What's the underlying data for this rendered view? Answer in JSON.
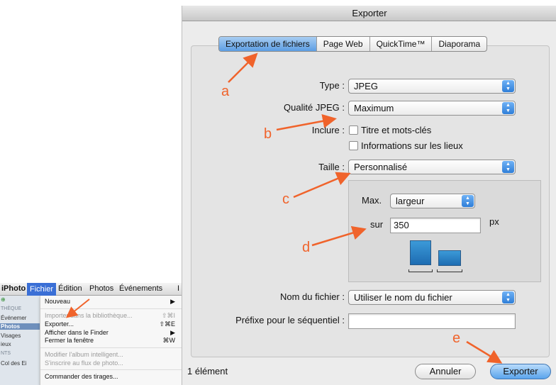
{
  "iphoto_menu": {
    "app_name": "iPhoto",
    "menus": [
      "Fichier",
      "Édition",
      "Photos",
      "Événements",
      "I"
    ],
    "sidebar": {
      "items": [
        {
          "label": "⊕",
          "type": "icon"
        },
        {
          "label": "THÈQUE",
          "type": "header"
        },
        {
          "label": "Événemer",
          "type": "item"
        },
        {
          "label": "Photos",
          "type": "selected"
        },
        {
          "label": "Visages",
          "type": "item"
        },
        {
          "label": "ieux",
          "type": "item"
        },
        {
          "label": "NTS",
          "type": "header"
        },
        {
          "label": "Col des Ei",
          "type": "item"
        }
      ]
    },
    "dropdown": {
      "items": [
        {
          "label": "Nouveau",
          "shortcut": "▶",
          "disabled": false
        },
        {
          "label": "Importer dans la bibliothèque...",
          "shortcut": "⇧⌘I",
          "disabled": true
        },
        {
          "label": "Exporter...",
          "shortcut": "⇧⌘E",
          "disabled": false
        },
        {
          "label": "Afficher dans le Finder",
          "shortcut": "▶",
          "disabled": false
        },
        {
          "label": "Fermer la fenêtre",
          "shortcut": "⌘W",
          "disabled": false
        },
        {
          "label": "Modifier l'album intelligent...",
          "shortcut": "",
          "disabled": true
        },
        {
          "label": "S'inscrire au flux de photo...",
          "shortcut": "",
          "disabled": true
        },
        {
          "label": "Commander des tirages...",
          "shortcut": "",
          "disabled": false
        }
      ]
    }
  },
  "dialog": {
    "title": "Exporter",
    "tabs": [
      "Exportation de fichiers",
      "Page Web",
      "QuickTime™",
      "Diaporama"
    ],
    "selected_tab": "Exportation de fichiers",
    "fields": {
      "type_label": "Type :",
      "type_value": "JPEG",
      "quality_label": "Qualité JPEG :",
      "quality_value": "Maximum",
      "include_label": "Inclure :",
      "include_title": "Titre et mots-clés",
      "include_location": "Informations sur les lieux",
      "size_label": "Taille :",
      "size_value": "Personnalisé",
      "max_label": "Max.",
      "max_value": "largeur",
      "on_label": "sur",
      "on_value": "350",
      "unit": "px",
      "filename_label": "Nom du fichier :",
      "filename_value": "Utiliser le nom du fichier",
      "prefix_label": "Préfixe pour le séquentiel :",
      "prefix_value": ""
    },
    "footer": {
      "count": "1 élément",
      "cancel": "Annuler",
      "export": "Exporter"
    }
  },
  "annotations": [
    "a",
    "b",
    "c",
    "d",
    "e"
  ],
  "colors": {
    "accent": "#3a6fd6",
    "annotation": "#f0632b",
    "selected_tab": "#5d9ee4"
  }
}
